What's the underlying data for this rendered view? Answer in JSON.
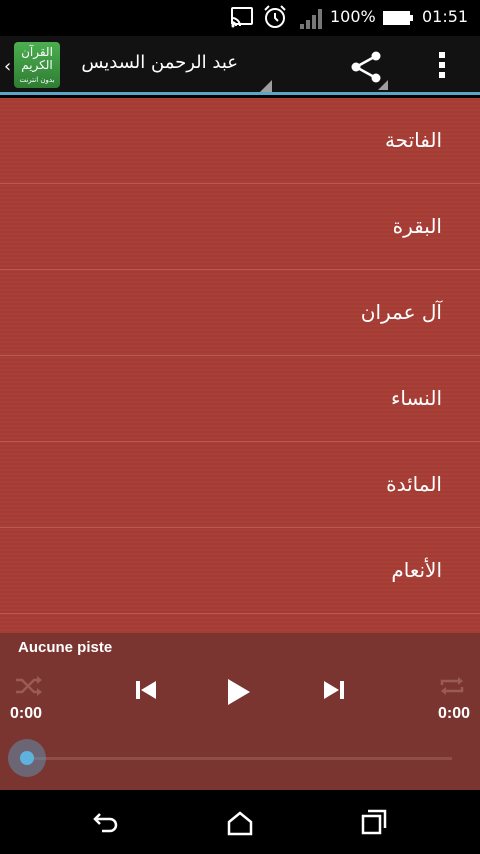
{
  "status_bar": {
    "battery_percent": "100%",
    "time": "01:51",
    "icons": [
      "cast-icon",
      "alarm-icon",
      "signal-icon",
      "battery-icon"
    ]
  },
  "action_bar": {
    "logo_text_line1": "القرآن",
    "logo_text_line2": "الكريم",
    "logo_text_small": "بدون انترنت",
    "reciter": "عبد الرحمن السديس",
    "accent_color": "#5aa6c8"
  },
  "surahs": [
    {
      "name": "الفاتحة"
    },
    {
      "name": "البقرة"
    },
    {
      "name": "آل عمران"
    },
    {
      "name": "النساء"
    },
    {
      "name": "المائدة"
    },
    {
      "name": "الأنعام"
    }
  ],
  "player": {
    "track_title": "Aucune piste",
    "time_elapsed": "0:00",
    "time_total": "0:00",
    "progress": 0
  },
  "colors": {
    "list_bg": "#a43c33",
    "player_bg": "#7a3530"
  }
}
